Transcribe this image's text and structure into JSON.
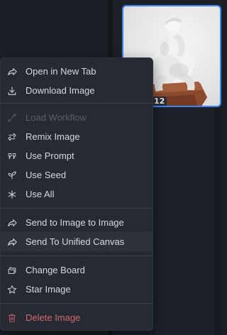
{
  "thumbnail": {
    "badge": "12",
    "alt": "Statue of a seated thinker on a wooden pedestal"
  },
  "menu": {
    "items": [
      {
        "label": "Open in New Tab",
        "icon": "share-arrow-icon",
        "state": "normal"
      },
      {
        "label": "Download Image",
        "icon": "download-icon",
        "state": "normal"
      },
      {
        "label": "Load Workflow",
        "icon": "flow-icon",
        "state": "disabled"
      },
      {
        "label": "Remix Image",
        "icon": "remix-icon",
        "state": "normal"
      },
      {
        "label": "Use Prompt",
        "icon": "quote-icon",
        "state": "normal"
      },
      {
        "label": "Use Seed",
        "icon": "seedling-icon",
        "state": "normal"
      },
      {
        "label": "Use All",
        "icon": "asterisk-icon",
        "state": "normal"
      },
      {
        "label": "Send to Image to Image",
        "icon": "share-arrow-icon",
        "state": "normal"
      },
      {
        "label": "Send To Unified Canvas",
        "icon": "share-arrow-icon",
        "state": "hover"
      },
      {
        "label": "Change Board",
        "icon": "folders-icon",
        "state": "normal"
      },
      {
        "label": "Star Image",
        "icon": "star-icon",
        "state": "normal"
      },
      {
        "label": "Delete Image",
        "icon": "trash-icon",
        "state": "danger"
      }
    ]
  },
  "colors": {
    "background": "#1b1e24",
    "menu": "#262a32",
    "text": "#d6d8dc",
    "disabled": "#5a5f68",
    "danger": "#d2686d",
    "selection_border": "#3b82f6"
  }
}
